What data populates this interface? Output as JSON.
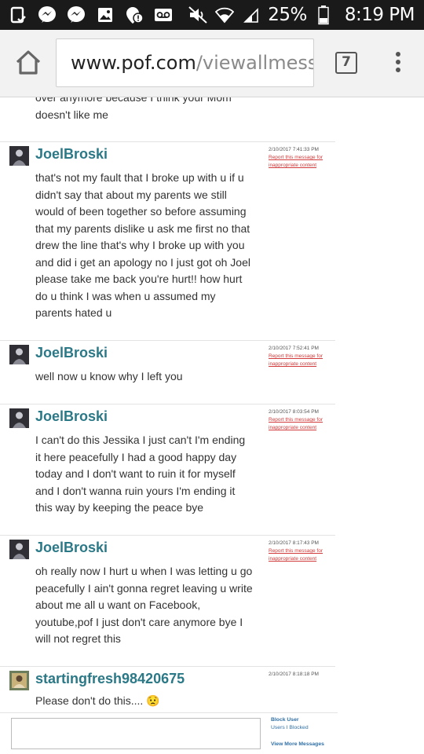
{
  "status_bar": {
    "battery": "25%",
    "time": "8:19 PM",
    "left_icons": [
      "clipboard-check-icon",
      "messenger-icon",
      "messenger-icon",
      "gallery-icon",
      "alert-location-icon",
      "voicemail-icon"
    ],
    "right_icons": [
      "mute-icon",
      "wifi-icon",
      "signal-icon",
      "battery-icon"
    ]
  },
  "browser": {
    "url_host": "www.pof.com",
    "url_path": "/viewallmessa",
    "tab_count": "7"
  },
  "conversation": {
    "partial_message": "over anymore because I think your Mom doesn't like me",
    "messages": [
      {
        "username": "JoelBroski",
        "timestamp": "2/10/2017 7:41:33 PM",
        "report": "Report this message for inappropriate content",
        "text": "that's not my fault that I broke up with u if u didn't say that about my parents we still would of been together so before assuming that my parents dislike u ask me first no that drew the line that's why I broke up with you and did i get an apology no I just got oh Joel please take me back you're hurt!! how hurt do u think I was when u assumed my parents hated u"
      },
      {
        "username": "JoelBroski",
        "timestamp": "2/10/2017 7:52:41 PM",
        "report": "Report this message for inappropriate content",
        "text": "well now u know why I left you"
      },
      {
        "username": "JoelBroski",
        "timestamp": "2/10/2017 8:03:54 PM",
        "report": "Report this message for inappropriate content",
        "text": "I can't do this Jessika I just can't I'm ending it here peacefully I had a good happy day today and I don't want to ruin it for myself and I don't wanna ruin yours I'm ending it this way by keeping the peace bye"
      },
      {
        "username": "JoelBroski",
        "timestamp": "2/10/2017 8:17:43 PM",
        "report": "Report this message for inappropriate content",
        "text": "oh really now I hurt u when I was letting u go peacefully I ain't gonna regret leaving u write about me all u want on Facebook, youtube,pof I just don't care anymore bye I will not regret this"
      },
      {
        "username": "startingfresh98420675",
        "timestamp": "2/10/2017 8:18:18 PM",
        "text": "Please don't do this....",
        "emoji": "😟"
      }
    ]
  },
  "reply": {
    "block_user": "Block User",
    "users_blocked": "Users I Blocked",
    "view_more": "View More Messages"
  },
  "colors": {
    "username": "#2b7887",
    "report_link": "#d23b3b",
    "reply_links": "#2f6fa5",
    "status_bar_bg": "#1a1a1a"
  }
}
